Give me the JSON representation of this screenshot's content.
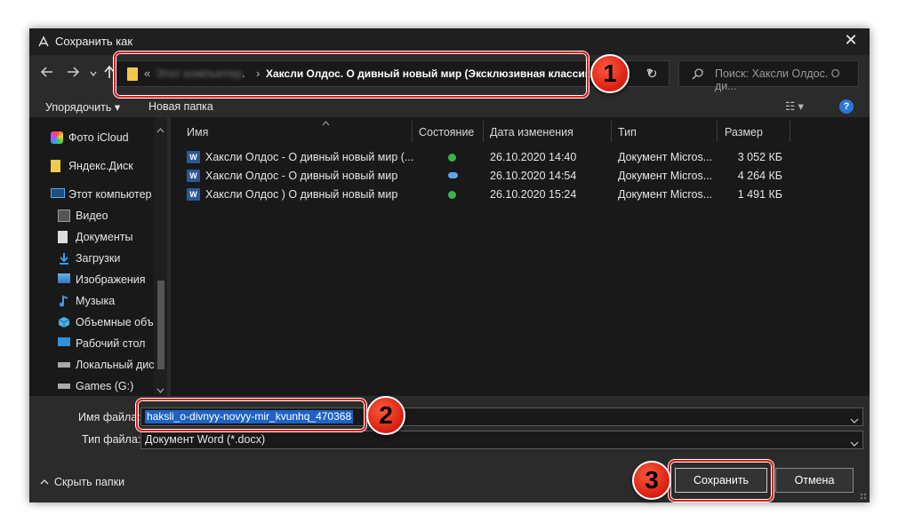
{
  "window": {
    "title": "Сохранить как",
    "close_symbol": "✕"
  },
  "addressbar": {
    "overflow": "«",
    "blurred_crumb": "Этот компьютер",
    "ellipsis": ".",
    "separator": "›",
    "current_folder": "Хаксли Олдос. О дивный новый мир (Эксклюзивная классика)",
    "refresh_symbol": "↻"
  },
  "search": {
    "placeholder": "Поиск: Хаксли Олдос. О ди..."
  },
  "toolbar": {
    "organize_label": "Упорядочить ▾",
    "new_folder_label": "Новая папка",
    "view_symbol": "☷ ▾",
    "help_symbol": "?"
  },
  "sidebar": {
    "items": [
      {
        "label": "Фото iCloud",
        "icon": "icloud-photos-icon"
      },
      {
        "label": "Яндекс.Диск",
        "icon": "yandex-disk-icon"
      },
      {
        "label": "Этот компьютер",
        "icon": "computer-icon"
      },
      {
        "label": "Видео",
        "icon": "video-icon"
      },
      {
        "label": "Документы",
        "icon": "documents-icon"
      },
      {
        "label": "Загрузки",
        "icon": "downloads-icon"
      },
      {
        "label": "Изображения",
        "icon": "pictures-icon"
      },
      {
        "label": "Музыка",
        "icon": "music-icon"
      },
      {
        "label": "Объемные объ",
        "icon": "3d-objects-icon"
      },
      {
        "label": "Рабочий стол",
        "icon": "desktop-icon"
      },
      {
        "label": "Локальный дис",
        "icon": "local-disk-icon"
      },
      {
        "label": "Games (G:)",
        "icon": "drive-icon"
      }
    ]
  },
  "file_list": {
    "columns": {
      "name": "Имя",
      "status": "Состояние",
      "date": "Дата изменения",
      "type": "Тип",
      "size": "Размер"
    },
    "rows": [
      {
        "name": "Хаксли Олдос - О дивный новый мир (...",
        "status": "synced",
        "date": "26.10.2020 14:40",
        "type": "Документ Micros...",
        "size": "3 052 КБ"
      },
      {
        "name": "Хаксли Олдос - О дивный новый мир",
        "status": "cloud",
        "date": "26.10.2020 14:54",
        "type": "Документ Micros...",
        "size": "4 264 КБ"
      },
      {
        "name": "Хаксли Олдос ) О дивный новый мир",
        "status": "synced",
        "date": "26.10.2020 15:24",
        "type": "Документ Micros...",
        "size": "1 491 КБ"
      }
    ]
  },
  "form": {
    "filename_label": "Имя файла:",
    "filename_value": "haksli_o-divnyy-novyy-mir_kvunhq_470368",
    "filetype_label": "Тип файла:",
    "filetype_value": "Документ Word (*.docx)"
  },
  "footer": {
    "hide_folders_label": "Скрыть папки",
    "save_label": "Сохранить",
    "cancel_label": "Отмена"
  },
  "annotations": {
    "badge1": "1",
    "badge2": "2",
    "badge3": "3",
    "highlight_color": "#e0201b"
  }
}
